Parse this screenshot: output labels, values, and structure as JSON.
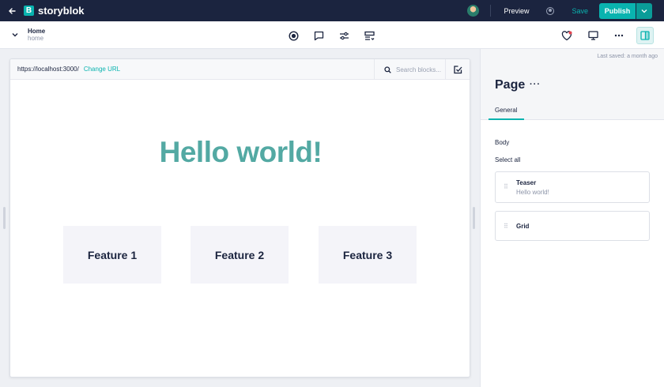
{
  "topbar": {
    "brand": "storyblok",
    "brand_letter": "B",
    "preview_label": "Preview",
    "save_label": "Save",
    "publish_label": "Publish"
  },
  "story": {
    "title": "Home",
    "slug": "home"
  },
  "preview": {
    "url": "https://localhost:3000/",
    "change_url_label": "Change URL",
    "search_placeholder": "Search blocks...",
    "hero_text": "Hello world!",
    "features": [
      "Feature 1",
      "Feature 2",
      "Feature 3"
    ]
  },
  "panel": {
    "last_saved": "Last saved: a month ago",
    "title": "Page",
    "menu_label": "···",
    "tabs": [
      {
        "label": "General",
        "active": true
      }
    ],
    "field_label": "Body",
    "select_all_label": "Select all",
    "blocks": [
      {
        "name": "Teaser",
        "subtitle": "Hello world!"
      },
      {
        "name": "Grid",
        "subtitle": ""
      }
    ]
  },
  "colors": {
    "navy": "#1b243f",
    "teal": "#09b3af",
    "hero_teal": "#53a9a3"
  }
}
